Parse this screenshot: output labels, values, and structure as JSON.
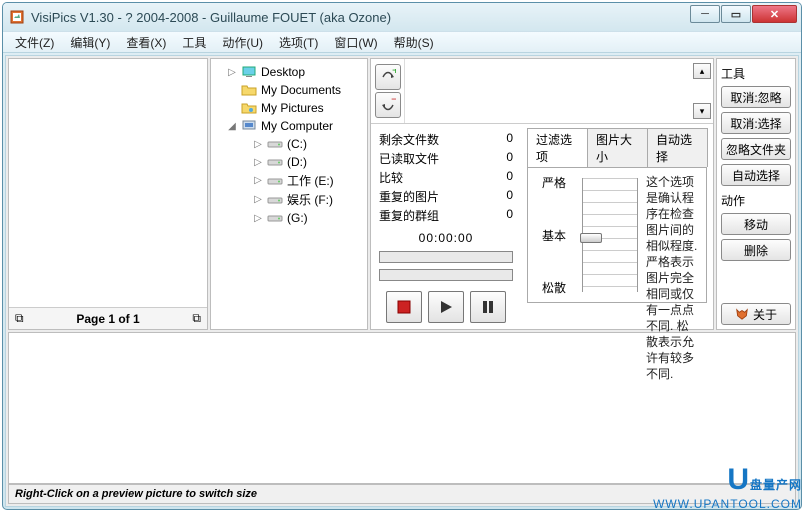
{
  "window": {
    "title": "VisiPics V1.30 - ? 2004-2008 - Guillaume FOUET (aka Ozone)"
  },
  "menu": {
    "items": [
      "文件(Z)",
      "编辑(Y)",
      "查看(X)",
      "工具",
      "动作(U)",
      "选项(T)",
      "窗口(W)",
      "帮助(S)"
    ]
  },
  "tree": {
    "desktop": "Desktop",
    "mydocs": "My Documents",
    "mypics": "My Pictures",
    "mycomp": "My Computer",
    "drives": [
      "(C:)",
      "(D:)",
      "工作 (E:)",
      "娱乐 (F:)",
      "(G:)"
    ]
  },
  "stats": {
    "labels": {
      "remain": "剩余文件数",
      "read": "已读取文件",
      "compare": "比较",
      "dupimg": "重复的图片",
      "dupgrp": "重复的群组"
    },
    "values": {
      "remain": "0",
      "read": "0",
      "compare": "0",
      "dupimg": "0",
      "dupgrp": "0"
    },
    "time": "00:00:00"
  },
  "tabs": {
    "filter": "过滤选项",
    "size": "图片大小",
    "auto": "自动选择"
  },
  "slider": {
    "strict": "严格",
    "basic": "基本",
    "loose": "松散"
  },
  "filter_desc": "这个选项是确认程序在检查图片间的相似程度. 严格表示图片完全相同或仅有一点点不同. 松散表示允许有较多不同.",
  "tools": {
    "label": "工具",
    "unignore": "取消:忽略",
    "unselect": "取消:选择",
    "ignorefolder": "忽略文件夹",
    "autoselect": "自动选择"
  },
  "actions": {
    "label": "动作",
    "move": "移动",
    "delete": "删除",
    "about": "关于"
  },
  "pager": {
    "text": "Page 1 of 1"
  },
  "status": {
    "hint": "Right-Click on a preview picture to switch size"
  },
  "watermark": {
    "line1_prefix": "U",
    "line1_rest": "盘量产网",
    "line2": "WWW.UPANTOOL.COM"
  }
}
